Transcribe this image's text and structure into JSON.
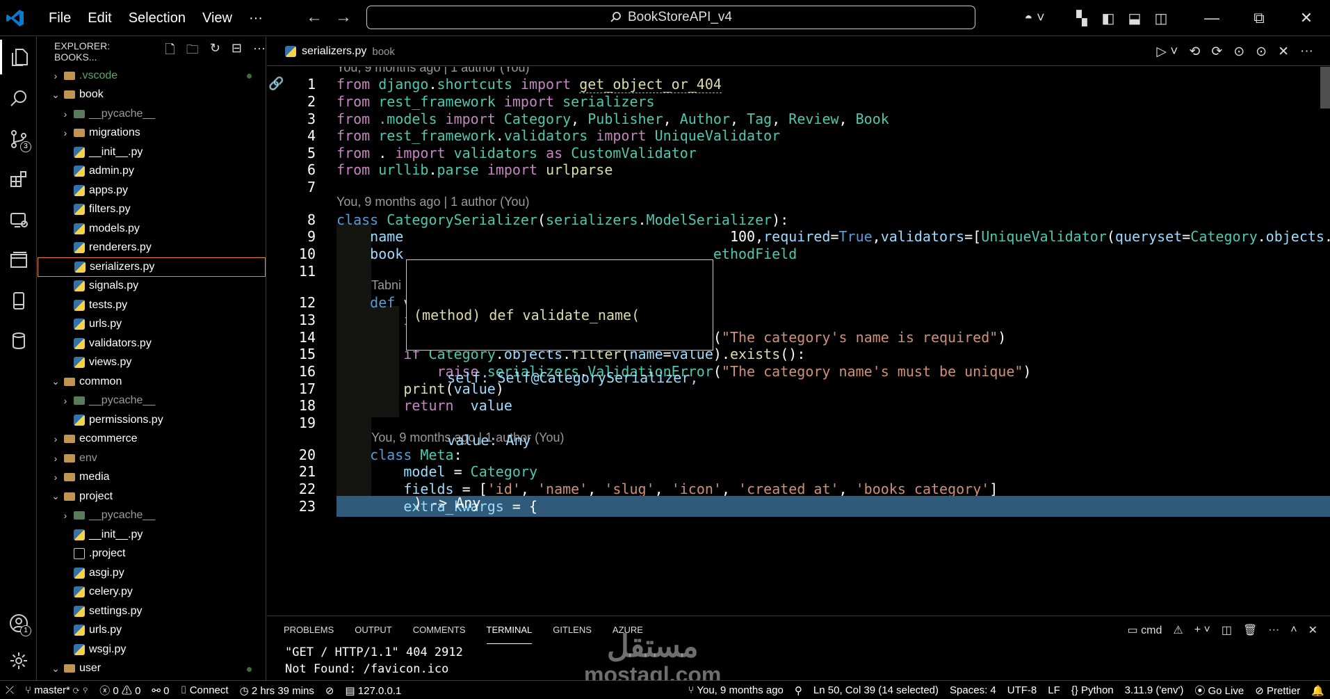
{
  "titlebar": {
    "menu": [
      "File",
      "Edit",
      "Selection",
      "View",
      "···"
    ],
    "search_text": "BookStoreAPI_v4"
  },
  "sidebar": {
    "title": "EXPLORER: BOOKS...",
    "tree": [
      {
        "label": ".vscode",
        "type": "folder",
        "depth": 0,
        "state": "collapsed",
        "style": "vscode",
        "dot": true
      },
      {
        "label": "book",
        "type": "folder",
        "depth": 0,
        "state": "expanded"
      },
      {
        "label": "__pycache__",
        "type": "pyfolder",
        "depth": 1,
        "state": "collapsed",
        "style": "dim"
      },
      {
        "label": "migrations",
        "type": "folder",
        "depth": 1,
        "state": "collapsed"
      },
      {
        "label": "__init__.py",
        "type": "py",
        "depth": 1
      },
      {
        "label": "admin.py",
        "type": "py",
        "depth": 1
      },
      {
        "label": "apps.py",
        "type": "py",
        "depth": 1
      },
      {
        "label": "filters.py",
        "type": "py",
        "depth": 1
      },
      {
        "label": "models.py",
        "type": "py",
        "depth": 1
      },
      {
        "label": "renderers.py",
        "type": "py",
        "depth": 1
      },
      {
        "label": "serializers.py",
        "type": "py",
        "depth": 1,
        "selected": true
      },
      {
        "label": "signals.py",
        "type": "py",
        "depth": 1
      },
      {
        "label": "tests.py",
        "type": "py",
        "depth": 1
      },
      {
        "label": "urls.py",
        "type": "py",
        "depth": 1
      },
      {
        "label": "validators.py",
        "type": "py",
        "depth": 1
      },
      {
        "label": "views.py",
        "type": "py",
        "depth": 1
      },
      {
        "label": "common",
        "type": "folder",
        "depth": 0,
        "state": "expanded"
      },
      {
        "label": "__pycache__",
        "type": "pyfolder",
        "depth": 1,
        "state": "collapsed",
        "style": "dim"
      },
      {
        "label": "permissions.py",
        "type": "py",
        "depth": 1
      },
      {
        "label": "ecommerce",
        "type": "folder",
        "depth": 0,
        "state": "collapsed"
      },
      {
        "label": "env",
        "type": "folder",
        "depth": 0,
        "state": "collapsed",
        "style": "dim"
      },
      {
        "label": "media",
        "type": "folder",
        "depth": 0,
        "state": "collapsed"
      },
      {
        "label": "project",
        "type": "folder",
        "depth": 0,
        "state": "expanded"
      },
      {
        "label": "__pycache__",
        "type": "pyfolder",
        "depth": 1,
        "state": "collapsed",
        "style": "dim"
      },
      {
        "label": "__init__.py",
        "type": "py",
        "depth": 1
      },
      {
        "label": ".project",
        "type": "file",
        "depth": 1
      },
      {
        "label": "asgi.py",
        "type": "py",
        "depth": 1
      },
      {
        "label": "celery.py",
        "type": "py",
        "depth": 1
      },
      {
        "label": "settings.py",
        "type": "py",
        "depth": 1
      },
      {
        "label": "urls.py",
        "type": "py",
        "depth": 1
      },
      {
        "label": "wsgi.py",
        "type": "py",
        "depth": 1
      },
      {
        "label": "user",
        "type": "folder",
        "depth": 0,
        "state": "expanded",
        "dot": true
      }
    ]
  },
  "tab": {
    "name": "serializers.py",
    "description": "book"
  },
  "codelens": {
    "top": "You, 9 months ago | 1 author (You)",
    "class": "You, 9 months ago | 1 author (You)",
    "tabnine": "Tabni",
    "meta": "You, 9 months ago | 1 author (You)"
  },
  "code_lines": [
    {
      "n": "1",
      "tokens": [
        [
          "from ",
          "ctrl"
        ],
        [
          "django",
          "imp"
        ],
        [
          ".",
          ""
        ],
        [
          "shortcuts",
          "imp"
        ],
        [
          " import ",
          "ctrl"
        ],
        [
          "get_object_or_404",
          "fn ul"
        ]
      ]
    },
    {
      "n": "2",
      "tokens": [
        [
          "from ",
          "ctrl"
        ],
        [
          "rest_framework",
          "imp"
        ],
        [
          " import ",
          "ctrl"
        ],
        [
          "serializers",
          "imp"
        ]
      ]
    },
    {
      "n": "3",
      "tokens": [
        [
          "from ",
          "ctrl"
        ],
        [
          ".models",
          "imp"
        ],
        [
          " import ",
          "ctrl"
        ],
        [
          "Category",
          "cls"
        ],
        [
          ", ",
          ""
        ],
        [
          "Publisher",
          "cls"
        ],
        [
          ", ",
          ""
        ],
        [
          "Author",
          "cls"
        ],
        [
          ", ",
          ""
        ],
        [
          "Tag",
          "cls"
        ],
        [
          ", ",
          ""
        ],
        [
          "Review",
          "cls"
        ],
        [
          ", ",
          ""
        ],
        [
          "Book",
          "cls"
        ]
      ]
    },
    {
      "n": "4",
      "tokens": [
        [
          "from ",
          "ctrl"
        ],
        [
          "rest_framework",
          "imp"
        ],
        [
          ".",
          ""
        ],
        [
          "validators",
          "imp"
        ],
        [
          " import ",
          "ctrl"
        ],
        [
          "UniqueValidator",
          "cls"
        ]
      ]
    },
    {
      "n": "5",
      "tokens": [
        [
          "from ",
          "ctrl"
        ],
        [
          ". ",
          ""
        ],
        [
          "import ",
          "ctrl"
        ],
        [
          "validators",
          "imp"
        ],
        [
          " as ",
          "ctrl"
        ],
        [
          "CustomValidator",
          "cls"
        ]
      ]
    },
    {
      "n": "6",
      "tokens": [
        [
          "from ",
          "ctrl"
        ],
        [
          "urllib",
          "imp"
        ],
        [
          ".",
          ""
        ],
        [
          "parse",
          "imp"
        ],
        [
          " import ",
          "ctrl"
        ],
        [
          "urlparse",
          "fn"
        ]
      ]
    },
    {
      "n": "7",
      "tokens": []
    },
    {
      "n": "8",
      "tokens": [
        [
          "class ",
          "kw"
        ],
        [
          "CategorySerializer",
          "cls"
        ],
        [
          "(",
          ""
        ],
        [
          "serializers",
          "imp"
        ],
        [
          ".",
          ""
        ],
        [
          "ModelSerializer",
          "cls"
        ],
        [
          "):",
          ""
        ]
      ]
    },
    {
      "n": "9",
      "tokens": [
        [
          "    ",
          ""
        ],
        [
          "name",
          "var"
        ],
        [
          "                                       100",
          ""
        ],
        [
          ",",
          ""
        ],
        [
          "required",
          "var"
        ],
        [
          "=",
          ""
        ],
        [
          "True",
          "kw"
        ],
        [
          ",",
          ""
        ],
        [
          "validators",
          "var"
        ],
        [
          "=[",
          ""
        ],
        [
          "UniqueValidator",
          "cls"
        ],
        [
          "(",
          ""
        ],
        [
          "queryset",
          "var"
        ],
        [
          "=",
          ""
        ],
        [
          "Category",
          "cls"
        ],
        [
          ".",
          ""
        ],
        [
          "objects",
          "var"
        ],
        [
          ".",
          ""
        ]
      ]
    },
    {
      "n": "10",
      "tokens": [
        [
          "    ",
          ""
        ],
        [
          "book",
          "var"
        ],
        [
          "                                     ethodField",
          "cls"
        ]
      ]
    },
    {
      "n": "11",
      "tokens": []
    },
    {
      "n": "12",
      "tokens": [
        [
          "    ",
          ""
        ],
        [
          "def ",
          "kw"
        ],
        [
          "validate_name",
          "fn"
        ],
        [
          "(",
          ""
        ],
        [
          "self",
          "var"
        ],
        [
          ", ",
          ""
        ],
        [
          "value",
          "var"
        ],
        [
          "):",
          ""
        ]
      ]
    },
    {
      "n": "13",
      "tokens": [
        [
          "        ",
          ""
        ],
        [
          "if ",
          "ctrl"
        ],
        [
          "value",
          "var"
        ],
        [
          " is ",
          "kw"
        ],
        [
          "None",
          "kw"
        ],
        [
          ":",
          ""
        ]
      ]
    },
    {
      "n": "14",
      "tokens": [
        [
          "            ",
          ""
        ],
        [
          "raise ",
          "ctrl"
        ],
        [
          "serializers",
          "imp"
        ],
        [
          ".",
          ""
        ],
        [
          "ValidationError",
          "cls"
        ],
        [
          "(",
          ""
        ],
        [
          "\"The category's name is required\"",
          "str"
        ],
        [
          ")",
          ""
        ]
      ]
    },
    {
      "n": "15",
      "tokens": [
        [
          "        ",
          ""
        ],
        [
          "if ",
          "ctrl"
        ],
        [
          "Category",
          "cls"
        ],
        [
          ".",
          ""
        ],
        [
          "objects",
          "var"
        ],
        [
          ".",
          ""
        ],
        [
          "filter",
          "fn"
        ],
        [
          "(",
          ""
        ],
        [
          "name",
          "var"
        ],
        [
          "=",
          ""
        ],
        [
          "value",
          "var"
        ],
        [
          ").",
          ""
        ],
        [
          "exists",
          "fn"
        ],
        [
          "():",
          ""
        ]
      ]
    },
    {
      "n": "16",
      "tokens": [
        [
          "            ",
          ""
        ],
        [
          "raise ",
          "ctrl"
        ],
        [
          "serializers",
          "imp"
        ],
        [
          ".",
          ""
        ],
        [
          "ValidationError",
          "cls"
        ],
        [
          "(",
          ""
        ],
        [
          "\"The category name's must be unique\"",
          "str"
        ],
        [
          ")",
          ""
        ]
      ]
    },
    {
      "n": "17",
      "tokens": [
        [
          "        ",
          ""
        ],
        [
          "print",
          "fn"
        ],
        [
          "(",
          ""
        ],
        [
          "value",
          "var"
        ],
        [
          ")",
          ""
        ]
      ]
    },
    {
      "n": "18",
      "tokens": [
        [
          "        ",
          ""
        ],
        [
          "return  ",
          "ctrl"
        ],
        [
          "value",
          "var"
        ]
      ]
    },
    {
      "n": "19",
      "tokens": []
    },
    {
      "n": "20",
      "tokens": [
        [
          "    ",
          ""
        ],
        [
          "class ",
          "kw"
        ],
        [
          "Meta",
          "cls"
        ],
        [
          ":",
          ""
        ]
      ]
    },
    {
      "n": "21",
      "tokens": [
        [
          "        ",
          ""
        ],
        [
          "model",
          "var"
        ],
        [
          " = ",
          ""
        ],
        [
          "Category",
          "cls"
        ]
      ]
    },
    {
      "n": "22",
      "tokens": [
        [
          "        ",
          ""
        ],
        [
          "fields",
          "var"
        ],
        [
          " = [",
          ""
        ],
        [
          "'id'",
          "str"
        ],
        [
          ", ",
          ""
        ],
        [
          "'name'",
          "str"
        ],
        [
          ", ",
          ""
        ],
        [
          "'slug'",
          "str"
        ],
        [
          ", ",
          ""
        ],
        [
          "'icon'",
          "str"
        ],
        [
          ", ",
          ""
        ],
        [
          "'created_at'",
          "str"
        ],
        [
          ", ",
          ""
        ],
        [
          "'books_category'",
          "str"
        ],
        [
          "]",
          ""
        ]
      ]
    },
    {
      "n": "23",
      "tokens": [
        [
          "        ",
          ""
        ],
        [
          "extra_kwargs",
          "var"
        ],
        [
          " = {",
          ""
        ]
      ]
    }
  ],
  "hover": {
    "lines": [
      "(method) def validate_name(",
      "    self: Self@CategorySerializer,",
      "    value: Any",
      ") -> Any"
    ]
  },
  "panel": {
    "tabs": [
      "PROBLEMS",
      "OUTPUT",
      "COMMENTS",
      "TERMINAL",
      "GITLENS",
      "AZURE"
    ],
    "active_tab": "TERMINAL",
    "shell": "cmd",
    "terminal_lines": [
      "\"GET / HTTP/1.1\" 404 2912",
      "Not Found: /favicon.ico"
    ]
  },
  "watermark": {
    "arabic": "مستقل",
    "latin": "mostaql.com"
  },
  "status": {
    "branch": "master*",
    "errors": "0",
    "warnings": "0",
    "ports": "0",
    "connect": "Connect",
    "time": "2 hrs 39 mins",
    "host": "127.0.0.1",
    "blame": "You, 9 months ago",
    "cursor": "Ln 50, Col 39 (14 selected)",
    "spaces": "Spaces: 4",
    "encoding": "UTF-8",
    "eol": "LF",
    "language": "Python",
    "interpreter": "3.11.9 ('env')",
    "golive": "Go Live",
    "prettier": "Prettier"
  },
  "badges": {
    "source_control": "3",
    "accounts": "1"
  }
}
